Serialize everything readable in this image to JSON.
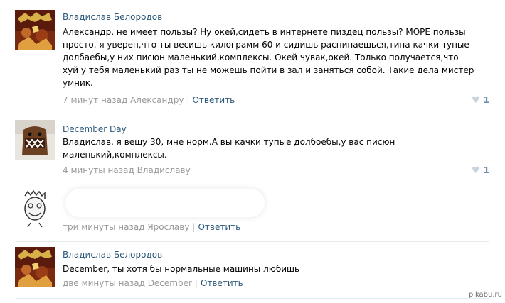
{
  "comments": [
    {
      "author": "Владислав Белородов",
      "text_lines": [
        "Александр, не имеет пользы? Ну окей,сидеть в интернете пиздец пользы? МОРЕ пользы",
        "просто. я уверен,что ты весишь килограмм 60 и сидишь распинаешься,типа качки тупые",
        "долбаебы,у них писюн маленький,комплексы. Окей чувак,окей. Только получается,что",
        "хуй у тебя маленький раз ты не можешь пойти в зал и заняться собой. Такие дела мистер",
        "умник."
      ],
      "time": "7 минут назад Александру",
      "reply_label": "Ответить",
      "likes": "1",
      "avatar_icon": "metal-band-album-cover"
    },
    {
      "author": "December Day",
      "text_lines": [
        "Владислав, я вешу 30, мне норм.А вы качки тупые долбоебы,у вас писюн",
        "маленький,комплексы."
      ],
      "time": "4 минуты назад Владиславу",
      "likes": "1",
      "avatar_icon": "domo-kun-plush"
    },
    {
      "author": "",
      "text_lines": [],
      "time": "три минуты назад Ярославу",
      "reply_label": "Ответить",
      "avatar_icon": "rage-comic-face"
    },
    {
      "author": "Владислав Белородов",
      "text_lines": [
        "December, ты хотя бы нормальные машины любишь"
      ],
      "time": "две минуты назад December",
      "reply_label": "Ответить",
      "avatar_icon": "metal-band-album-cover"
    }
  ],
  "watermark": "pikabu.ru",
  "colors": {
    "link": "#2b587a",
    "meta": "#999999",
    "like_count": "#6d8fb3",
    "divider": "#e7eaed"
  }
}
